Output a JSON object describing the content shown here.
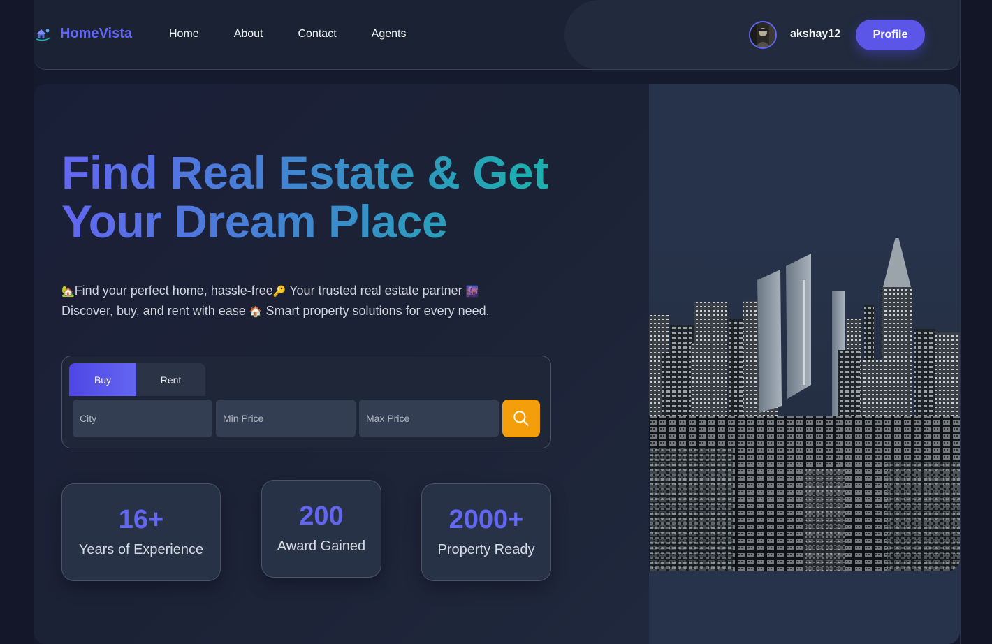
{
  "brand": {
    "name": "HomeVista"
  },
  "nav": {
    "links": [
      {
        "label": "Home"
      },
      {
        "label": "About"
      },
      {
        "label": "Contact"
      },
      {
        "label": "Agents"
      }
    ]
  },
  "user": {
    "name": "akshay12",
    "profile_label": "Profile"
  },
  "hero": {
    "title_line1": "Find Real Estate & Get",
    "title_line2": "Your Dream Place",
    "desc_line1_part1": "Find your perfect home, hassle-free",
    "desc_line1_part2": " Your trusted real estate partner ",
    "desc_line2_part1": "Discover, buy, and rent with ease ",
    "desc_line2_part2": " Smart property solutions for every need."
  },
  "search": {
    "tabs": [
      {
        "label": "Buy"
      },
      {
        "label": "Rent"
      }
    ],
    "active_tab": "Buy",
    "city_placeholder": "City",
    "min_price_placeholder": "Min Price",
    "max_price_placeholder": "Max Price"
  },
  "stats": [
    {
      "value": "16+",
      "label": "Years of Experience"
    },
    {
      "value": "200",
      "label": "Award Gained"
    },
    {
      "value": "2000+",
      "label": "Property Ready"
    }
  ],
  "colors": {
    "accent": "#6366f1",
    "search_button": "#f59e0b",
    "title_gradient_end": "#14b8a6"
  },
  "icons": [
    "house-logo-icon",
    "house-emoji-icon",
    "key-emoji-icon",
    "city-emoji-icon",
    "home-emoji-icon",
    "search-icon"
  ]
}
